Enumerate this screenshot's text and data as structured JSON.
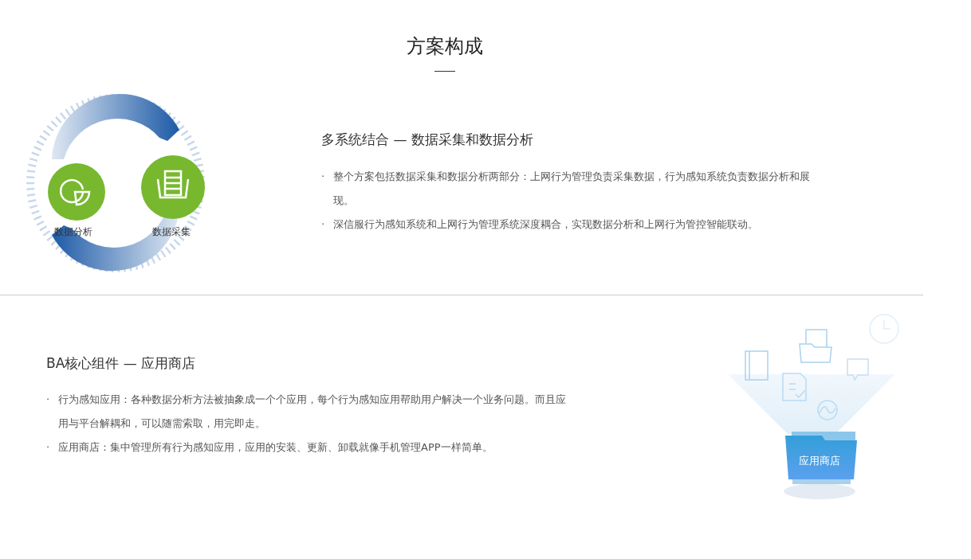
{
  "page_title": "方案构成",
  "sections": [
    {
      "heading": "多系统结合 — 数据采集和数据分析",
      "illustration": {
        "kind": "cycle",
        "labels": [
          "数据分析",
          "数据采集"
        ]
      },
      "points": [
        {
          "bullet": "·",
          "text": "整个方案包括数据采集和数据分析两部分：上网行为管理负责采集数据，行为感知系统负责数据分析和展现。"
        },
        {
          "bullet": "·",
          "text": "深信服行为感知系统和上网行为管理系统深度耦合，实现数据分析和上网行为管控智能联动。"
        }
      ]
    },
    {
      "heading": "BA核心组件 — 应用商店",
      "illustration": {
        "kind": "store",
        "labels": [
          "应用商店"
        ]
      },
      "points": [
        {
          "bullet": "·",
          "text": "行为感知应用：各种数据分析方法被抽象成一个个应用，每个行为感知应用帮助用户解决一个业务问题。而且应用与平台解耦和，可以随需索取，用完即走。"
        },
        {
          "bullet": "·",
          "text": "应用商店：集中管理所有行为感知应用，应用的安装、更新、卸载就像手机管理APP一样简单。"
        }
      ]
    }
  ]
}
